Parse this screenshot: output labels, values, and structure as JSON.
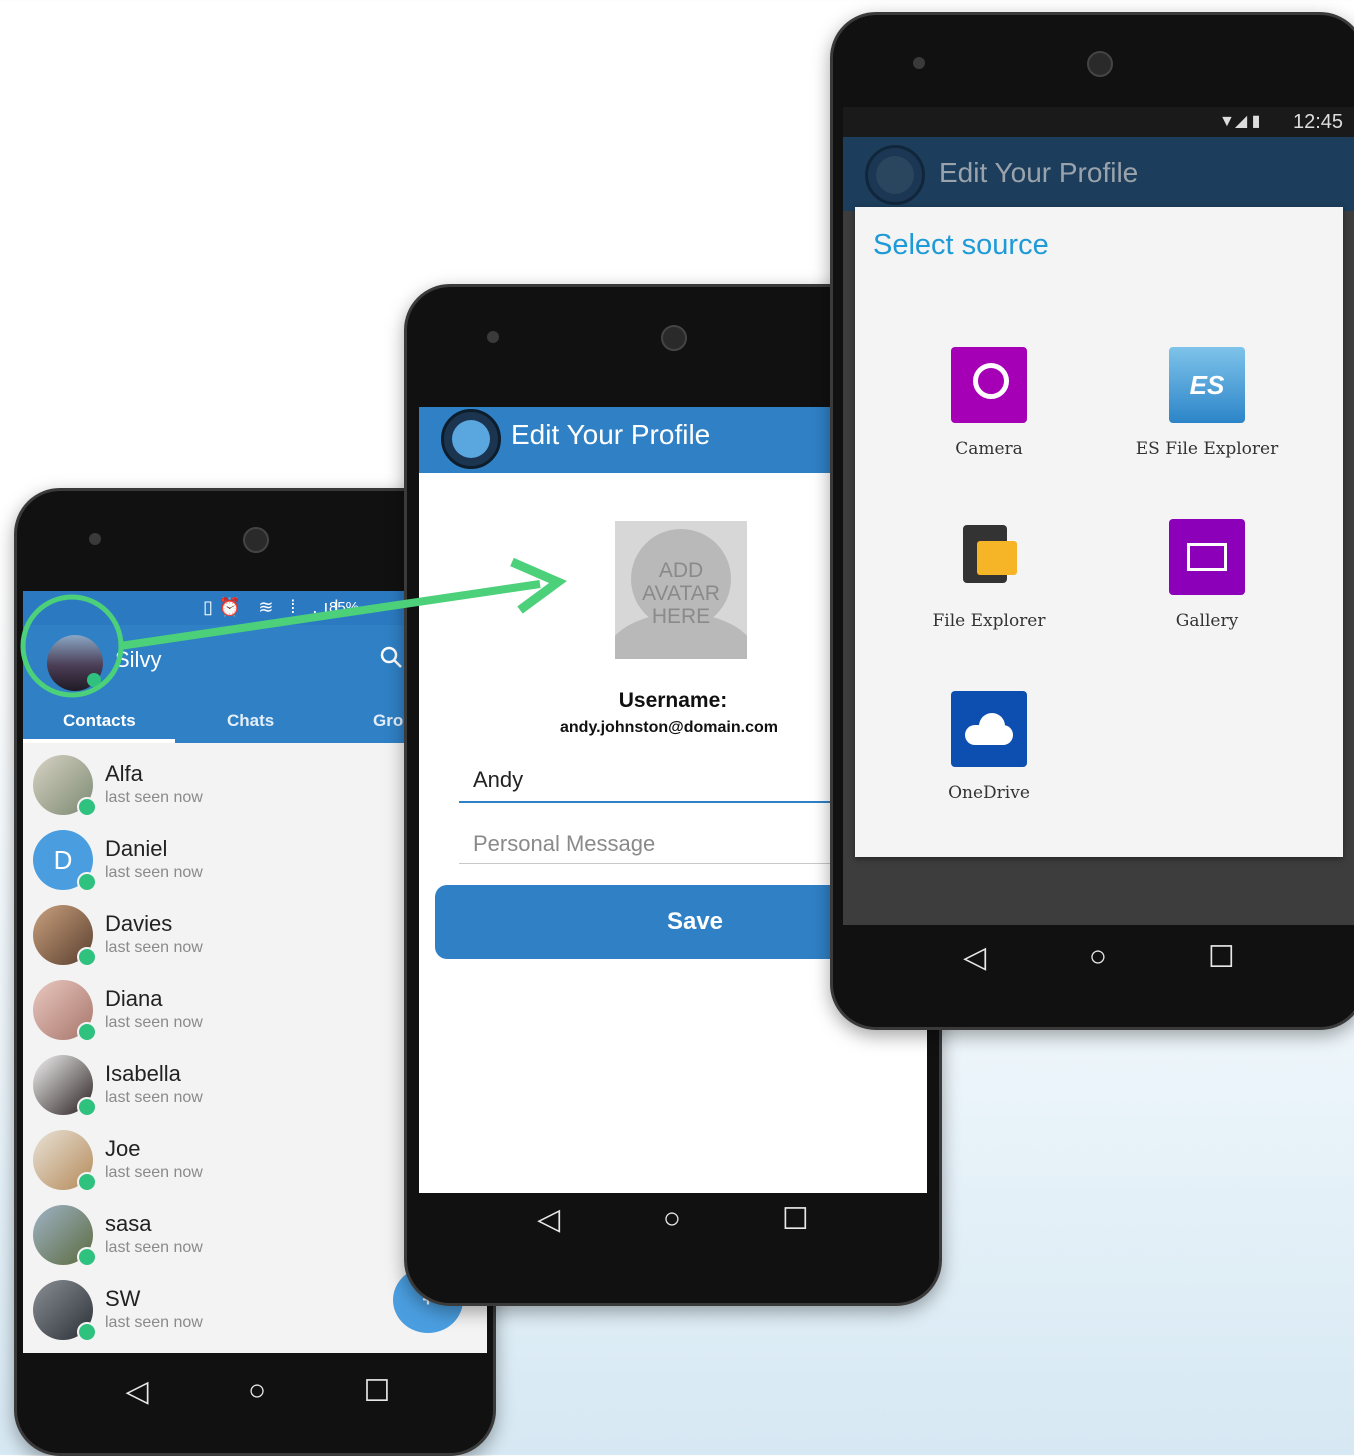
{
  "colors": {
    "primary": "#2f80c5",
    "accent_arrow": "#4cd07a",
    "presence": "#2ec27e",
    "camera": "#a500b5",
    "gallery": "#8b00b8",
    "onedrive": "#0d4fb0"
  },
  "phone1": {
    "status": {
      "battery_text": "85%"
    },
    "header": {
      "name": "Silvy",
      "search_icon": "search-icon"
    },
    "tabs": [
      {
        "label": "Contacts",
        "active": true
      },
      {
        "label": "Chats",
        "active": false
      },
      {
        "label": "Grou",
        "active": false
      }
    ],
    "contacts": [
      {
        "name": "Alfa",
        "status": "last seen now"
      },
      {
        "name": "Daniel",
        "status": "last seen now",
        "initial": "D"
      },
      {
        "name": "Davies",
        "status": "last seen now"
      },
      {
        "name": "Diana",
        "status": "last seen now"
      },
      {
        "name": "Isabella",
        "status": "last seen now"
      },
      {
        "name": "Joe",
        "status": "last seen now"
      },
      {
        "name": "sasa",
        "status": "last seen now"
      },
      {
        "name": "SW",
        "status": "last seen now"
      }
    ],
    "fab_label": "+"
  },
  "phone2": {
    "title": "Edit Your Profile",
    "avatar_placeholder": [
      "ADD",
      "AVATAR",
      "HERE"
    ],
    "username_label": "Username:",
    "username_value": "andy.johnston@domain.com",
    "name_value": "Andy",
    "message_placeholder": "Personal Message",
    "save_label": "Save"
  },
  "phone3": {
    "status_time": "12:45",
    "title": "Edit Your Profile",
    "dialog_title": "Select source",
    "sources": [
      {
        "label": "Camera",
        "icon": "camera-icon"
      },
      {
        "label": "ES File Explorer",
        "icon": "es-file-explorer-icon"
      },
      {
        "label": "File Explorer",
        "icon": "file-explorer-icon"
      },
      {
        "label": "Gallery",
        "icon": "gallery-icon"
      },
      {
        "label": "OneDrive",
        "icon": "onedrive-icon"
      }
    ]
  }
}
